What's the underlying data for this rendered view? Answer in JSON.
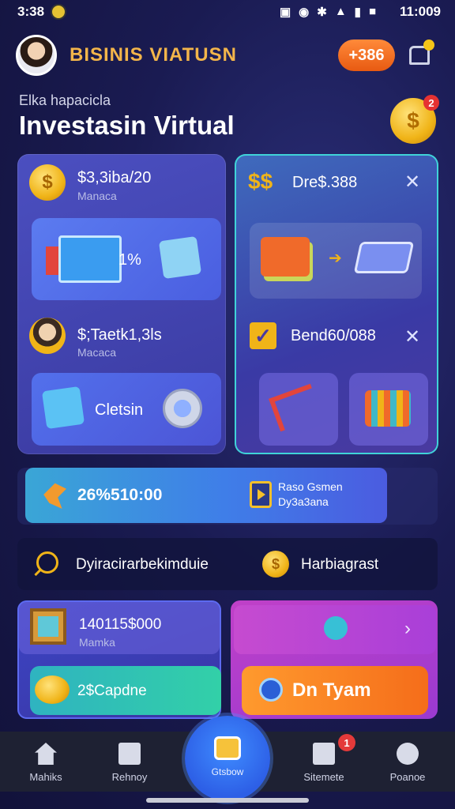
{
  "status_bar": {
    "time_left": "3:38",
    "time_right": "11:009"
  },
  "header": {
    "brand": "BISINIS VIATUSN",
    "points_badge": "+386",
    "subtitle": "Elka hapacicla",
    "title": "Investasin Virtual",
    "gold_badge_count": "2"
  },
  "left_panel": {
    "row1_value": "$3,3iba/20",
    "row1_sub": "Manaca",
    "card_a_label": "1%",
    "row2_value": "$;Taetk1,3ls",
    "row2_sub": "Macaca",
    "card_b_label": "Cletsin"
  },
  "right_panel": {
    "row1_value": "Dre$.388",
    "row2_value": "Bend60/088"
  },
  "progress_bar": {
    "value": "26%510:00",
    "label_line1": "Raso Gsmen",
    "label_line2": "Dy3a3ana"
  },
  "info_row": {
    "text1": "Dyiracirarbekimduie",
    "text2": "Harbiagrast"
  },
  "bottom_left": {
    "value": "140115$000",
    "sub": "Mamka",
    "button": "2$Capdne"
  },
  "bottom_right": {
    "button": "Dn Tyam"
  },
  "nav": {
    "items": [
      {
        "label": "Mahiks",
        "icon": "home-icon"
      },
      {
        "label": "Rehnoy",
        "icon": "inbox-icon"
      },
      {
        "label": "Gtsbow",
        "icon": "wallet-icon"
      },
      {
        "label": "Sitemete",
        "icon": "list-icon"
      },
      {
        "label": "Poanoe",
        "icon": "user-icon"
      }
    ],
    "badge": "1"
  },
  "colors": {
    "accent_orange": "#f56d1a",
    "accent_gold": "#f0b418",
    "accent_teal": "#3fd3d8",
    "accent_purple": "#c040c8"
  }
}
